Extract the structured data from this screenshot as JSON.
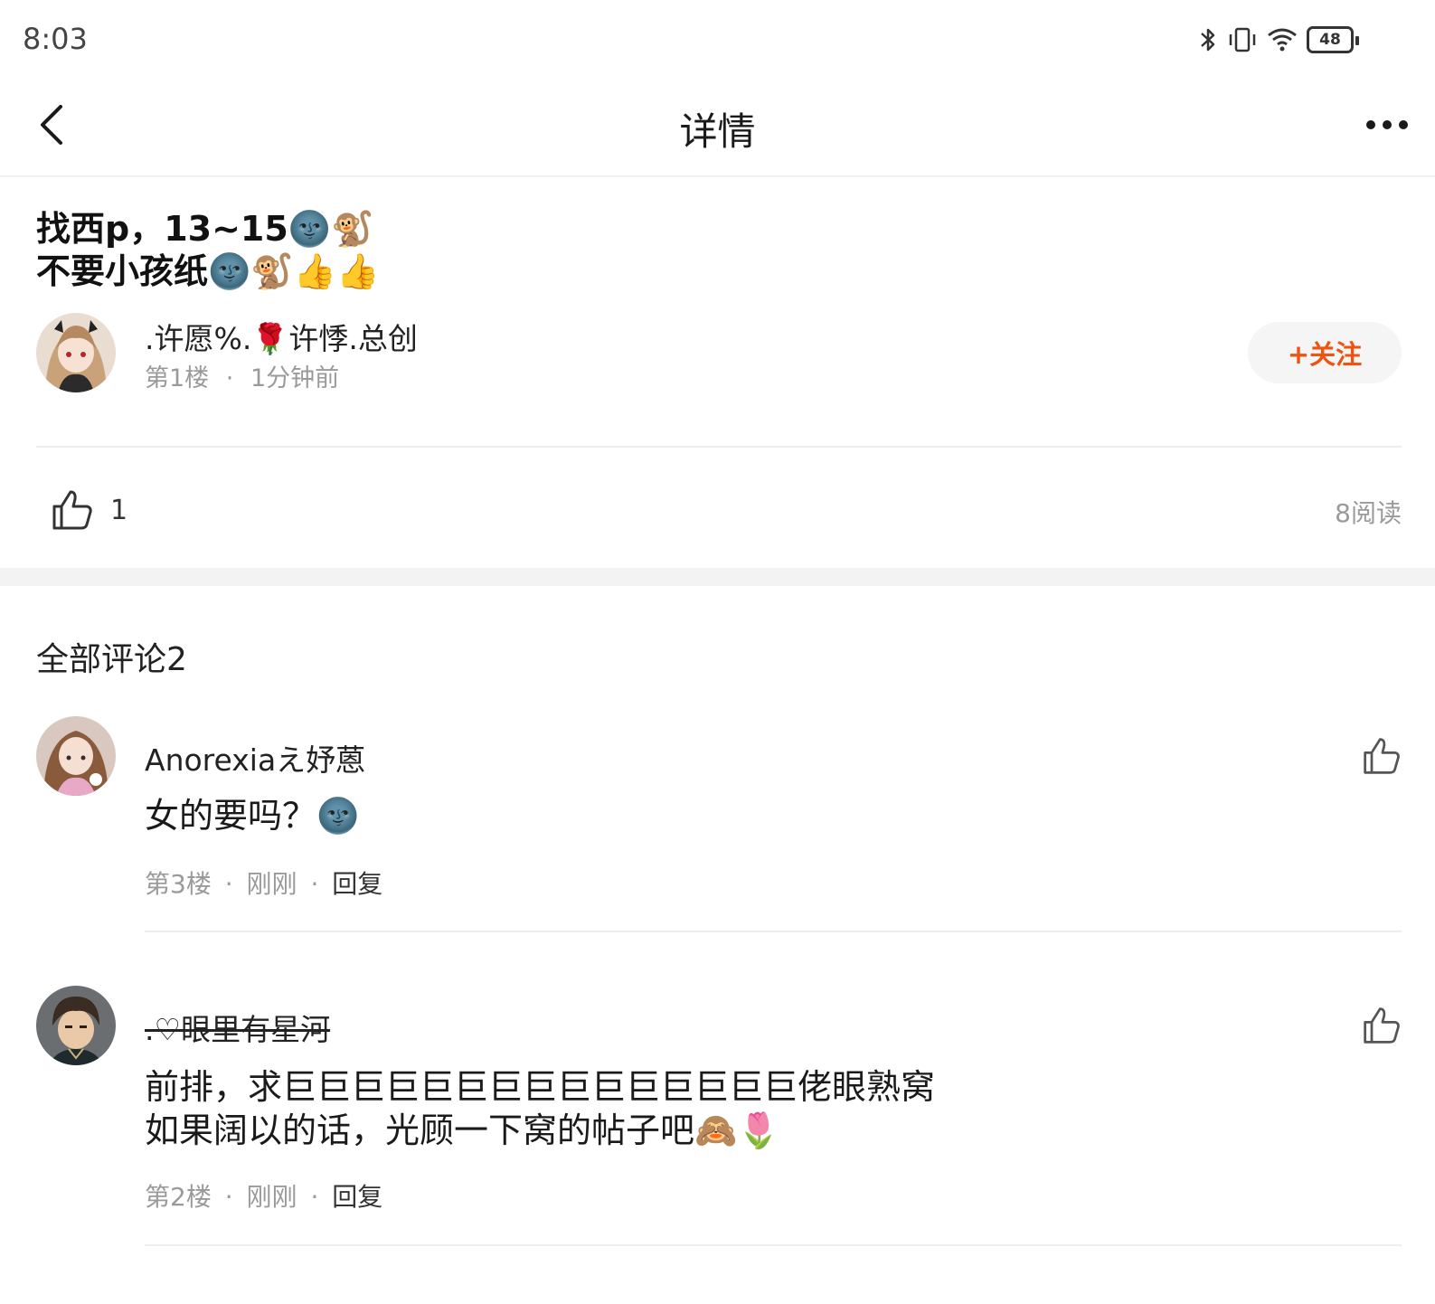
{
  "status_bar": {
    "time": "8:03",
    "battery": "48",
    "icons": [
      "bluetooth-icon",
      "vibrate-icon",
      "wifi-icon",
      "battery-icon"
    ]
  },
  "nav": {
    "title": "详情",
    "back_icon": "chevron-left-icon",
    "more_icon": "more-dots-icon"
  },
  "post": {
    "title_line1": "找西p，13~15🌚🐒",
    "title_line2": "不要小孩纸🌚🐒👍👍",
    "author_name": ".许愿%.🌹许悸.总创",
    "floor": "第1楼",
    "separator": "·",
    "time": "1分钟前",
    "follow_label": "+关注",
    "like_count": "1",
    "read_count": "8阅读"
  },
  "comments_header": "全部评论2",
  "comments": [
    {
      "user": "Anorexiaえ妤蒽",
      "lines": [
        "女的要吗？🌚"
      ],
      "floor": "第3楼",
      "time": "刚刚",
      "reply": "回复",
      "sep": "·"
    },
    {
      "user": ".♡眼里有星河",
      "lines": [
        "前排，求巨巨巨巨巨巨巨巨巨巨巨巨巨巨巨佬眼熟窝",
        "如果阔以的话，光顾一下窝的帖子吧🙈🌷"
      ],
      "floor": "第2楼",
      "time": "刚刚",
      "reply": "回复",
      "sep": "·"
    }
  ],
  "colors": {
    "accent": "#f0530f",
    "muted": "#9a9a9a",
    "divider": "#eeeeee"
  }
}
